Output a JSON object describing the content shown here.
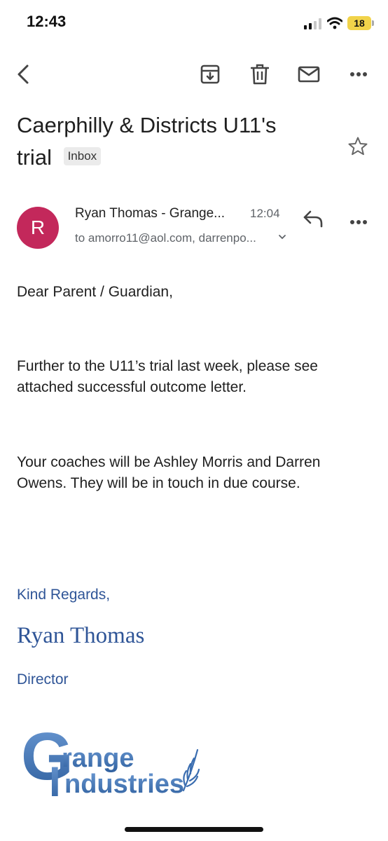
{
  "status_bar": {
    "time": "12:43",
    "battery": "18"
  },
  "toolbar": {
    "back_icon": "chevron-left-icon",
    "archive_icon": "archive-icon",
    "delete_icon": "trash-icon",
    "unread_icon": "mail-icon",
    "more_icon": "more-horizontal-icon"
  },
  "email": {
    "subject_line1": "Caerphilly & Districts U11's",
    "subject_line2": "trial",
    "label": "Inbox",
    "sender_initial": "R",
    "sender_name": "Ryan Thomas - Grange...",
    "time": "12:04",
    "recipients": "to amorro11@aol.com, darrenpo...",
    "body": {
      "greeting": "Dear Parent / Guardian,",
      "para1_line1": "Further to the U11’s trial last week, please see",
      "para1_line2": "attached successful outcome letter.",
      "para2_line1": "Your coaches will be Ashley Morris and Darren",
      "para2_line2": "Owens.  They will be in touch in due course."
    },
    "signature": {
      "closing": "Kind Regards,",
      "name": "Ryan Thomas",
      "title": "Director",
      "logo_text_1": "range",
      "logo_text_2": "ndustries",
      "logo_letter_1": "G",
      "logo_letter_2": "I"
    }
  },
  "colors": {
    "avatar": "#c3285b",
    "signature_blue": "#2f5597",
    "logo_blue": "#4a7fc1",
    "battery": "#f1d34a"
  }
}
